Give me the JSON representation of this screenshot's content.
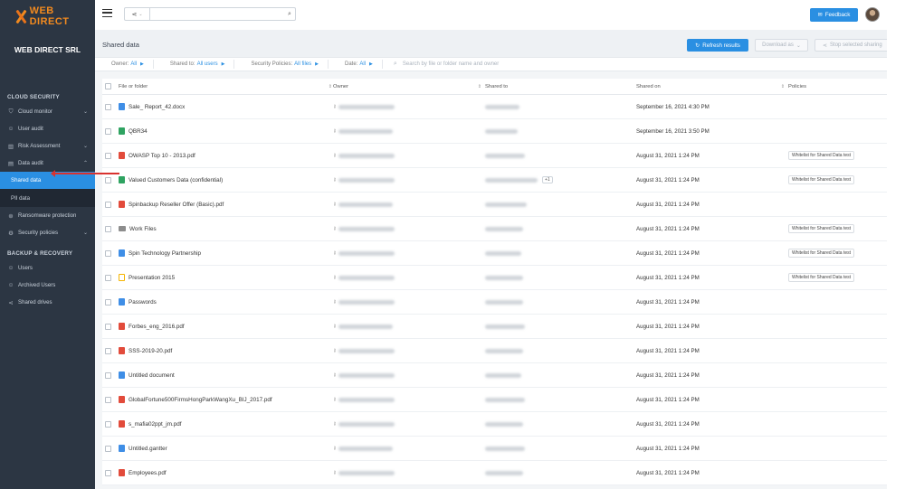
{
  "brand": {
    "logo_text": "WEB DIRECT",
    "org_name": "WEB DIRECT SRL",
    "accent": "#2a8fe2",
    "logo_color": "#f28a1f"
  },
  "sidebar": {
    "cloud_security_title": "CLOUD SECURITY",
    "backup_title": "BACKUP & RECOVERY",
    "items": [
      {
        "label": "Cloud monitor",
        "icon": "shield-icon"
      },
      {
        "label": "User audit",
        "icon": "user-icon"
      },
      {
        "label": "Risk Assessment",
        "icon": "chart-icon"
      },
      {
        "label": "Data audit",
        "icon": "document-icon"
      },
      {
        "label": "Shared data"
      },
      {
        "label": "PII data"
      },
      {
        "label": "Ransomware protection",
        "icon": "ransomware-icon"
      },
      {
        "label": "Security policies",
        "icon": "policy-icon"
      },
      {
        "label": "Users",
        "icon": "users-icon"
      },
      {
        "label": "Archived Users",
        "icon": "archive-icon"
      },
      {
        "label": "Shared drives",
        "icon": "share-icon"
      }
    ]
  },
  "topbar": {
    "search_placeholder": "",
    "feedback_label": "Feedback"
  },
  "page": {
    "title": "Shared data",
    "refresh_label": "Refresh results",
    "download_label": "Download as",
    "stop_label": "Stop selected sharing"
  },
  "filters": {
    "owner_label": "Owner:",
    "owner_value": "All",
    "shared_to_label": "Shared to:",
    "shared_to_value": "All users",
    "policies_label": "Security Policies:",
    "policies_value": "All files",
    "date_label": "Date:",
    "date_value": "All",
    "search_placeholder": "Search by file or folder name and owner"
  },
  "table": {
    "headers": {
      "file": "File or folder",
      "owner": "Owner",
      "shared_to": "Shared to",
      "shared_on": "Shared on",
      "policies": "Policies"
    },
    "rows": [
      {
        "name": "Sale_ Report_42.docx",
        "type": "doc",
        "shared_on": "September 16, 2021 4:30 PM",
        "policy": "",
        "extra": ""
      },
      {
        "name": "QBR34",
        "type": "sheet",
        "shared_on": "September 16, 2021 3:50 PM",
        "policy": "",
        "extra": ""
      },
      {
        "name": "OWASP Top 10 - 2013.pdf",
        "type": "pdf",
        "shared_on": "August 31, 2021 1:24 PM",
        "policy": "Whitelist for Shared Data test",
        "extra": ""
      },
      {
        "name": "Valued Customers Data (confidential)",
        "type": "sheet",
        "shared_on": "August 31, 2021 1:24 PM",
        "policy": "Whitelist for Shared Data test",
        "extra": "+1"
      },
      {
        "name": "Spinbackup Reseller Offer (Basic).pdf",
        "type": "pdf",
        "shared_on": "August 31, 2021 1:24 PM",
        "policy": "",
        "extra": ""
      },
      {
        "name": "Work Files",
        "type": "folder",
        "shared_on": "August 31, 2021 1:24 PM",
        "policy": "Whitelist for Shared Data test",
        "extra": ""
      },
      {
        "name": "Spin Technology Partnership",
        "type": "doc",
        "shared_on": "August 31, 2021 1:24 PM",
        "policy": "Whitelist for Shared Data test",
        "extra": ""
      },
      {
        "name": "Presentation 2015",
        "type": "slides",
        "shared_on": "August 31, 2021 1:24 PM",
        "policy": "Whitelist for Shared Data test",
        "extra": ""
      },
      {
        "name": "Passwords",
        "type": "doc",
        "shared_on": "August 31, 2021 1:24 PM",
        "policy": "",
        "extra": ""
      },
      {
        "name": "Forbes_eng_2016.pdf",
        "type": "pdf",
        "shared_on": "August 31, 2021 1:24 PM",
        "policy": "",
        "extra": ""
      },
      {
        "name": "SSS-2019-20.pdf",
        "type": "pdf",
        "shared_on": "August 31, 2021 1:24 PM",
        "policy": "",
        "extra": ""
      },
      {
        "name": "Untitled document",
        "type": "doc",
        "shared_on": "August 31, 2021 1:24 PM",
        "policy": "",
        "extra": ""
      },
      {
        "name": "GlobalFortune500FirmsHongParkWangXu_BIJ_2017.pdf",
        "type": "pdf",
        "shared_on": "August 31, 2021 1:24 PM",
        "policy": "",
        "extra": ""
      },
      {
        "name": "s_mafia02ppt_jm.pdf",
        "type": "pdf",
        "shared_on": "August 31, 2021 1:24 PM",
        "policy": "",
        "extra": ""
      },
      {
        "name": "Untitled.gantter",
        "type": "doc",
        "shared_on": "August 31, 2021 1:24 PM",
        "policy": "",
        "extra": ""
      },
      {
        "name": "Employees.pdf",
        "type": "pdf",
        "shared_on": "August 31, 2021 1:24 PM",
        "policy": "",
        "extra": ""
      }
    ]
  }
}
